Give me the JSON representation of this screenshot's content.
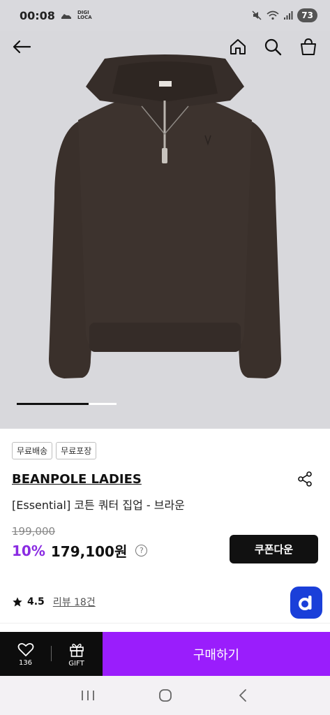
{
  "status": {
    "time": "00:08",
    "logo_line1": "DIGI",
    "logo_line2": "LOCA",
    "battery": "73"
  },
  "topnav": {
    "back_icon": "arrow-left-icon",
    "home_icon": "home-icon",
    "search_icon": "search-icon",
    "bag_icon": "shopping-bag-icon"
  },
  "carousel": {
    "progress": 0.72
  },
  "product": {
    "tags": [
      "무료배송",
      "무료포장"
    ],
    "brand": "BEANPOLE LADIES",
    "name": "[Essential] 코튼 쿼터 집업 - 브라운",
    "original_price": "199,000",
    "discount": "10%",
    "price": "179,100원",
    "price_help": "?",
    "coupon_label": "쿠폰다운",
    "rating": "4.5",
    "review_link": "리뷰 18건"
  },
  "bottom_bar": {
    "wish_count": "136",
    "gift_label": "GIFT",
    "buy_label": "구매하기"
  },
  "colors": {
    "accent": "#9a1dfc",
    "discount": "#8a2be2",
    "badge": "#1a3fd9",
    "sweater": "#3a302b"
  }
}
